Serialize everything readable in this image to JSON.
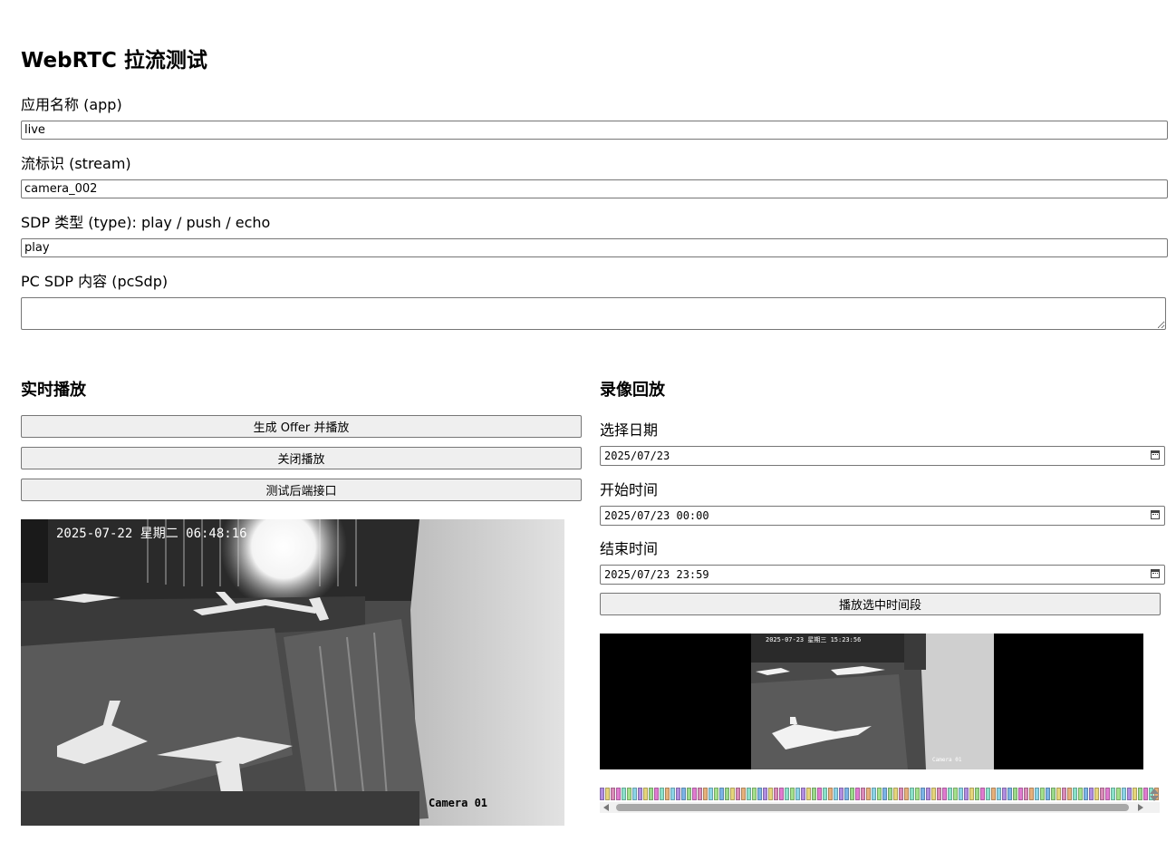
{
  "page": {
    "title": "WebRTC 拉流测试"
  },
  "form": {
    "app_label": "应用名称 (app)",
    "app_value": "live",
    "stream_label": "流标识 (stream)",
    "stream_value": "camera_002",
    "type_label": "SDP 类型 (type): play / push / echo",
    "type_value": "play",
    "pcsdp_label": "PC SDP 内容 (pcSdp)",
    "pcsdp_value": ""
  },
  "live": {
    "heading": "实时播放",
    "buttons": [
      "生成 Offer 并播放",
      "关闭播放",
      "测试后端接口"
    ],
    "osd_datetime": "2025-07-22 星期二 06:48:16",
    "osd_camera": "Camera 01"
  },
  "playback": {
    "heading": "录像回放",
    "date_label": "选择日期",
    "date_value": "2025/07/23",
    "start_label": "开始时间",
    "start_value": "2025/07/23 00:00",
    "end_label": "结束时间",
    "end_value": "2025/07/23 23:59",
    "play_button": "播放选中时间段",
    "osd_datetime": "2025-07-23 星期三 15:23:56",
    "osd_camera": "Camera 01"
  },
  "timeline": {
    "colors": [
      "#b08de0",
      "#e07bd0",
      "#8bd3e6",
      "#9ad98a",
      "#e6b07b",
      "#7bb3e6",
      "#d98ab8",
      "#a3e08b",
      "#e6d57b",
      "#8be0c9"
    ],
    "segments": 103
  }
}
